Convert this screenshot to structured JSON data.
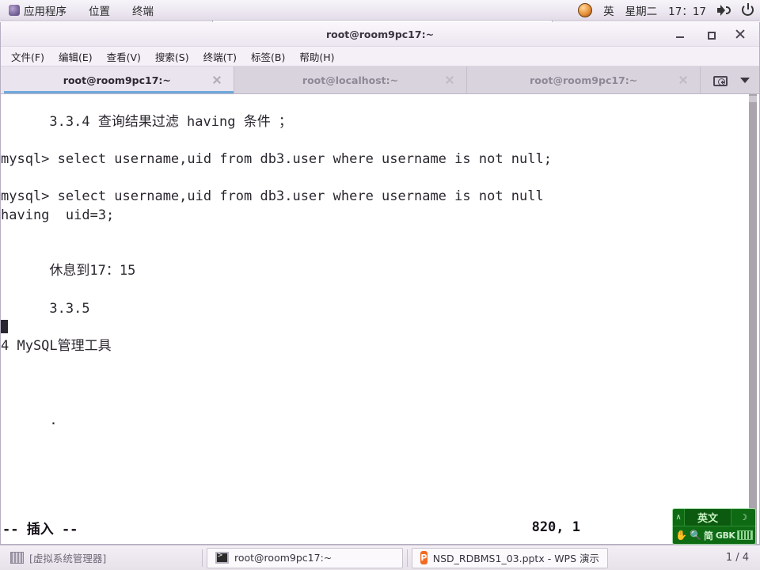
{
  "panel": {
    "menu": [
      {
        "label": "应用程序",
        "icon": "applications-icon"
      },
      {
        "label": "位置",
        "icon": null
      },
      {
        "label": "终端",
        "icon": null
      }
    ],
    "indicator_lang": "英",
    "day": "星期二",
    "clock": "17：17",
    "icons": [
      "ime-orb-icon",
      "volume-icon",
      "power-icon"
    ]
  },
  "window": {
    "title": "root@room9pc17:~",
    "buttons": {
      "minimize": "minimize-button",
      "maximize": "maximize-button",
      "close": "close-button"
    }
  },
  "menubar": [
    "文件(F)",
    "编辑(E)",
    "查看(V)",
    "搜索(S)",
    "终端(T)",
    "标签(B)",
    "帮助(H)"
  ],
  "tabs": [
    {
      "label": "root@room9pc17:~",
      "active": true
    },
    {
      "label": "root@localhost:~",
      "active": false
    },
    {
      "label": "root@room9pc17:~",
      "active": false
    }
  ],
  "tabbar_actions": {
    "new_tab": "new-tab-icon",
    "tab_list": "tab-list-caret-icon"
  },
  "terminal": {
    "lines": [
      "",
      "      3.3.4 查询结果过滤 having 条件 ；",
      "",
      "mysql> select username,uid from db3.user where username is not null;",
      "",
      "mysql> select username,uid from db3.user where username is not null",
      "having  uid=3;",
      "",
      "",
      "      休息到17：15",
      "",
      "      3.3.5",
      "",
      "4 MySQL管理工具",
      "",
      "",
      "",
      "      ."
    ],
    "cursor_line_index": 12,
    "cursor_col": 0
  },
  "vim": {
    "mode": "-- 插入 --",
    "position": "820, 1"
  },
  "ime": {
    "lang": "英文",
    "chevron": "∧",
    "moon": "☽",
    "quote": "”",
    "hand": "✋",
    "magnifier": "🔍",
    "shape": "简",
    "encoding": "GBK",
    "keyboard": "keyboard-icon",
    "color": "#0e6b14"
  },
  "taskbar": {
    "items": [
      {
        "label": "[虚拟系统管理器]",
        "icon": "virt-manager-icon",
        "state": "flat"
      },
      {
        "label": "root@room9pc17:~",
        "icon": "terminal-icon",
        "state": "raised"
      },
      {
        "label": "NSD_RDBMS1_03.pptx - WPS 演示",
        "icon": "wps-icon",
        "state": "raised"
      }
    ],
    "page_indicator": "1 / 4"
  }
}
